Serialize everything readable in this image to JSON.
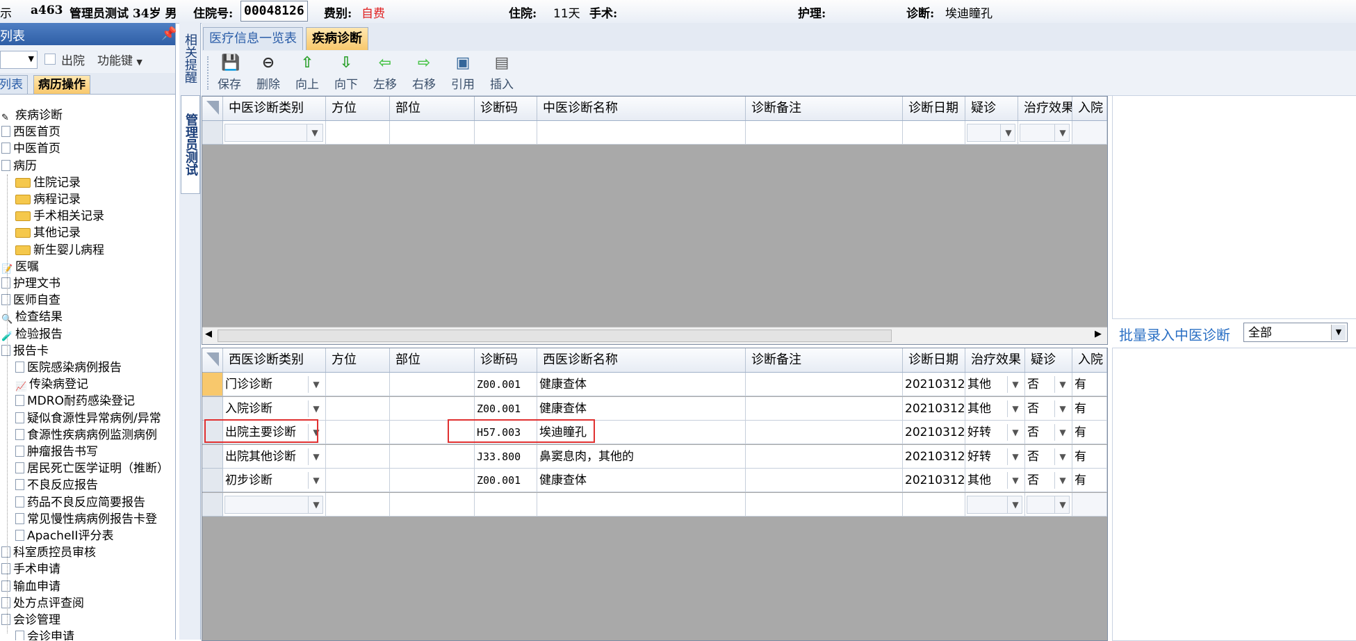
{
  "header": {
    "fragment_left": "示",
    "bed": "a463",
    "patient": "管理员测试 34岁 男",
    "hosp_label": "住院号:",
    "hosp_no": "00048126",
    "fee_label": "费别:",
    "fee_value": "自费",
    "stay_label": "住院:",
    "stay_value": "11天",
    "surgery_label": "手术:",
    "surgery_value": "",
    "nursing_label": "护理:",
    "nursing_value": "",
    "diag_label": "诊断:",
    "diag_value": "埃迪瞳孔"
  },
  "left_panel": {
    "title": "列表",
    "pin_icon": "pin-icon",
    "discharge_label": "出院",
    "function_key_label": "功能键",
    "tabs": [
      "列表",
      "病历操作"
    ],
    "active_tab": "病历操作"
  },
  "tree": [
    {
      "label": "疾病诊断",
      "icon": "pencil-icon",
      "level": 0
    },
    {
      "label": "西医首页",
      "icon": "doc-icon",
      "level": 0
    },
    {
      "label": "中医首页",
      "icon": "doc-icon",
      "level": 0
    },
    {
      "label": "病历",
      "icon": "doc-icon",
      "level": 0
    },
    {
      "label": "住院记录",
      "icon": "folder-icon",
      "level": 1
    },
    {
      "label": "病程记录",
      "icon": "folder-icon",
      "level": 1
    },
    {
      "label": "手术相关记录",
      "icon": "folder-icon",
      "level": 1
    },
    {
      "label": "其他记录",
      "icon": "folder-icon",
      "level": 1
    },
    {
      "label": "新生婴儿病程",
      "icon": "folder-icon",
      "level": 1
    },
    {
      "label": "医嘱",
      "icon": "memo-icon",
      "level": 0
    },
    {
      "label": "护理文书",
      "icon": "doc-icon",
      "level": 0
    },
    {
      "label": "医师自查",
      "icon": "doc-icon",
      "level": 0
    },
    {
      "label": "检查结果",
      "icon": "magnifier-icon",
      "level": 0
    },
    {
      "label": "检验报告",
      "icon": "test-tube-icon",
      "level": 0
    },
    {
      "label": "报告卡",
      "icon": "doc-icon",
      "level": 0
    },
    {
      "label": "医院感染病例报告",
      "icon": "doc-icon",
      "level": 1
    },
    {
      "label": "传染病登记",
      "icon": "chart-doc-icon",
      "level": 1
    },
    {
      "label": "MDRO耐药感染登记",
      "icon": "doc-icon",
      "level": 1
    },
    {
      "label": "疑似食源性异常病例/异常",
      "icon": "doc-icon",
      "level": 1
    },
    {
      "label": "食源性疾病病例监测病例",
      "icon": "doc-icon",
      "level": 1
    },
    {
      "label": "肿瘤报告书写",
      "icon": "doc-icon",
      "level": 1
    },
    {
      "label": "居民死亡医学证明（推断）",
      "icon": "doc-icon",
      "level": 1
    },
    {
      "label": "不良反应报告",
      "icon": "doc-icon",
      "level": 1
    },
    {
      "label": "药品不良反应简要报告",
      "icon": "doc-icon",
      "level": 1
    },
    {
      "label": "常见慢性病病例报告卡登",
      "icon": "doc-icon",
      "level": 1
    },
    {
      "label": "ApacheII评分表",
      "icon": "doc-icon",
      "level": 1
    },
    {
      "label": "科室质控员审核",
      "icon": "doc-icon",
      "level": 0
    },
    {
      "label": "手术申请",
      "icon": "doc-icon",
      "level": 0
    },
    {
      "label": "输血申请",
      "icon": "doc-icon",
      "level": 0
    },
    {
      "label": "处方点评查阅",
      "icon": "doc-icon",
      "level": 0
    },
    {
      "label": "会诊管理",
      "icon": "doc-icon",
      "level": 0
    },
    {
      "label": "会诊申请",
      "icon": "doc-icon",
      "level": 1
    }
  ],
  "vstrip": {
    "tab1": "相关提醒",
    "tab2": "管理员测试"
  },
  "main_tabs": [
    "医疗信息一览表",
    "疾病诊断"
  ],
  "active_main_tab": "疾病诊断",
  "toolbar": [
    {
      "label": "保存",
      "icon": "save-icon",
      "glyph": "💾",
      "color": "#1a7a1a"
    },
    {
      "label": "删除",
      "icon": "delete-icon",
      "glyph": "⊖",
      "color": "#333333"
    },
    {
      "label": "向上",
      "icon": "arrow-up-icon",
      "glyph": "⇧",
      "color": "#2aa02a"
    },
    {
      "label": "向下",
      "icon": "arrow-down-icon",
      "glyph": "⇩",
      "color": "#2aa02a"
    },
    {
      "label": "左移",
      "icon": "arrow-left-icon",
      "glyph": "⇦",
      "color": "#4cc44c"
    },
    {
      "label": "右移",
      "icon": "arrow-right-icon",
      "glyph": "⇨",
      "color": "#4cc44c"
    },
    {
      "label": "引用",
      "icon": "quote-icon",
      "glyph": "▣",
      "color": "#336699"
    },
    {
      "label": "插入",
      "icon": "insert-icon",
      "glyph": "▤",
      "color": "#555555"
    }
  ],
  "tcm_grid": {
    "headers": [
      "中医诊断类别",
      "方位",
      "部位",
      "诊断码",
      "中医诊断名称",
      "诊断备注",
      "诊断日期",
      "疑诊",
      "治疗效果",
      "入院"
    ]
  },
  "wm_grid": {
    "headers": [
      "西医诊断类别",
      "方位",
      "部位",
      "诊断码",
      "西医诊断名称",
      "诊断备注",
      "诊断日期",
      "治疗效果",
      "疑诊",
      "入院"
    ],
    "rows": [
      {
        "category": "门诊诊断",
        "code": "Z00.001",
        "name": "健康查体",
        "date": "20210312",
        "effect": "其他",
        "suspect": "否",
        "admit": "有"
      },
      {
        "category": "入院诊断",
        "code": "Z00.001",
        "name": "健康查体",
        "date": "20210312",
        "effect": "其他",
        "suspect": "否",
        "admit": "有"
      },
      {
        "category": "出院主要诊断",
        "code": "H57.003",
        "name": "埃迪瞳孔",
        "date": "20210312",
        "effect": "好转",
        "suspect": "否",
        "admit": "有"
      },
      {
        "category": "出院其他诊断",
        "code": "J33.800",
        "name": "鼻窦息肉，其他的",
        "date": "20210312",
        "effect": "好转",
        "suspect": "否",
        "admit": "有"
      },
      {
        "category": "初步诊断",
        "code": "Z00.001",
        "name": "健康查体",
        "date": "20210312",
        "effect": "其他",
        "suspect": "否",
        "admit": "有"
      }
    ]
  },
  "batch": {
    "label": "批量录入中医诊断",
    "select_value": "全部"
  },
  "colors": {
    "accent_tab": "#f8c86c",
    "fee": "#e02020",
    "highlight_box": "#e03030",
    "link": "#2a6fc4"
  }
}
